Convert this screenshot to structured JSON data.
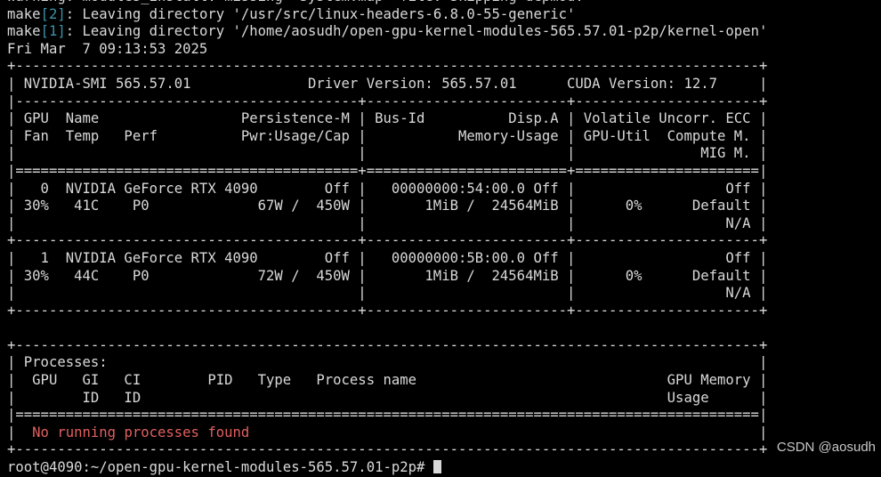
{
  "terminal": {
    "lines": [
      {
        "text": "Warning: modules_install: missing 'System.map' file. Skipping depmod."
      },
      {
        "segments": [
          {
            "text": "make"
          },
          {
            "text": "[2]",
            "color": "teal"
          },
          {
            "text": ": Leaving directory '/usr/src/linux-headers-6.8.0-55-generic'"
          }
        ]
      },
      {
        "segments": [
          {
            "text": "make"
          },
          {
            "text": "[1]",
            "color": "teal"
          },
          {
            "text": ": Leaving directory '/home/aosudh/open-gpu-kernel-modules-565.57.01-p2p/kernel-open'"
          }
        ]
      },
      {
        "text": "Fri Mar  7 09:13:53 2025"
      },
      {
        "text": "+-----------------------------------------------------------------------------------------+"
      },
      {
        "text": "| NVIDIA-SMI 565.57.01              Driver Version: 565.57.01      CUDA Version: 12.7     |"
      },
      {
        "text": "|-----------------------------------------+------------------------+----------------------+"
      },
      {
        "text": "| GPU  Name                 Persistence-M | Bus-Id          Disp.A | Volatile Uncorr. ECC |"
      },
      {
        "text": "| Fan  Temp   Perf          Pwr:Usage/Cap |           Memory-Usage | GPU-Util  Compute M. |"
      },
      {
        "text": "|                                         |                        |               MIG M. |"
      },
      {
        "text": "|=========================================+========================+======================|"
      },
      {
        "text": "|   0  NVIDIA GeForce RTX 4090        Off |   00000000:54:00.0 Off |                  Off |"
      },
      {
        "text": "| 30%   41C    P0             67W /  450W |       1MiB /  24564MiB |      0%      Default |"
      },
      {
        "text": "|                                         |                        |                  N/A |"
      },
      {
        "text": "+-----------------------------------------+------------------------+----------------------+"
      },
      {
        "text": "|   1  NVIDIA GeForce RTX 4090        Off |   00000000:5B:00.0 Off |                  Off |"
      },
      {
        "text": "| 30%   44C    P0             72W /  450W |       1MiB /  24564MiB |      0%      Default |"
      },
      {
        "text": "|                                         |                        |                  N/A |"
      },
      {
        "text": "+-----------------------------------------+------------------------+----------------------+"
      },
      {
        "text": ""
      },
      {
        "text": "+-----------------------------------------------------------------------------------------+"
      },
      {
        "text": "| Processes:                                                                              |"
      },
      {
        "text": "|  GPU   GI   CI        PID   Type   Process name                              GPU Memory |"
      },
      {
        "text": "|        ID   ID                                                               Usage      |"
      },
      {
        "text": "|=========================================================================================|"
      },
      {
        "segments": [
          {
            "text": "|  "
          },
          {
            "text": "No running processes found",
            "color": "red"
          },
          {
            "text": "                                                             |"
          }
        ]
      },
      {
        "text": "+-----------------------------------------------------------------------------------------+"
      },
      {
        "text": "root@4090:~/open-gpu-kernel-modules-565.57.01-p2p# ",
        "cursor": true
      }
    ]
  },
  "watermark": "CSDN @aosudh"
}
